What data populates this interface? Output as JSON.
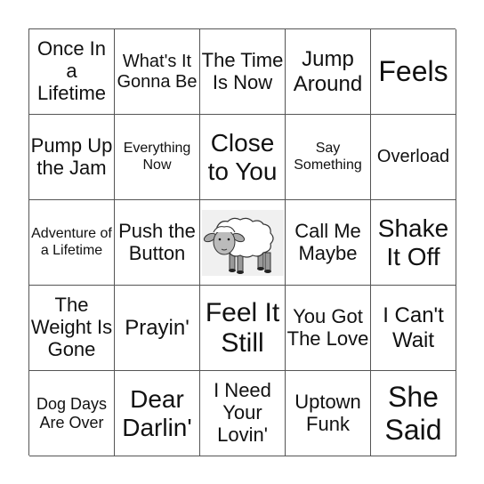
{
  "card": {
    "cells": [
      "Once In a Lifetime",
      "What's It Gonna Be",
      "The Time Is Now",
      "Jump Around",
      "Feels",
      "Pump Up the Jam",
      "Everything Now",
      "Close to You",
      "Say Something",
      "Overload",
      "Adventure of a Lifetime",
      "Push the Button",
      "",
      "Call Me Maybe",
      "Shake It Off",
      "The Weight Is Gone",
      "Prayin'",
      "Feel It Still",
      "You Got The Love",
      "I Can't Wait",
      "Dog Days Are Over",
      "Dear Darlin'",
      "I Need Your Lovin'",
      "Uptown Funk",
      "She Said"
    ],
    "free_space_icon": "sheep-icon"
  }
}
